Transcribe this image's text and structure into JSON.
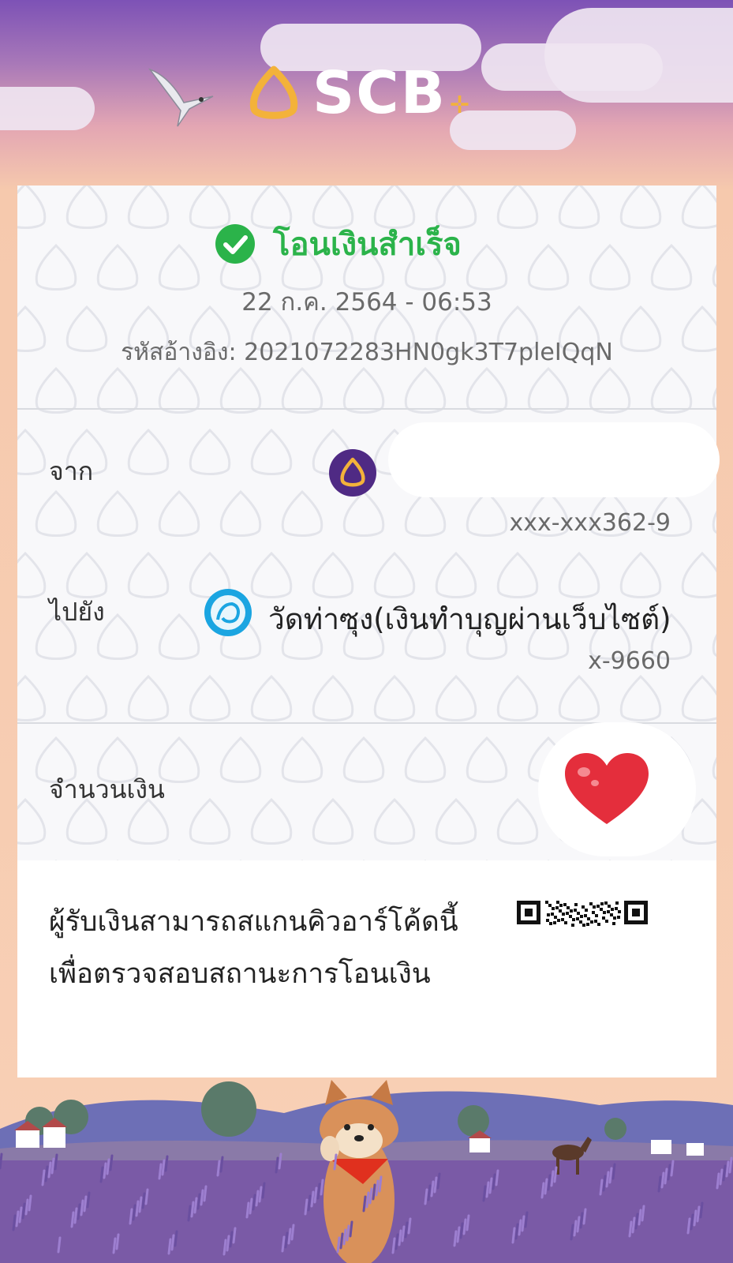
{
  "brand": {
    "name": "SCB",
    "colors": {
      "purple": "#4f2a84",
      "gold": "#f3b23a",
      "success": "#2bb34a"
    }
  },
  "receipt": {
    "status": "โอนเงินสำเร็จ",
    "datetime": "22 ก.ค. 2564 - 06:53",
    "reference": "รหัสอ้างอิง: 2021072283HN0gk3T7pleIQqN",
    "from": {
      "label": "จาก",
      "account": "xxx-xxx362-9",
      "bank_icon": "scb-logo-icon"
    },
    "to": {
      "label": "ไปยัง",
      "name": "วัดท่าซุง(เงินทำบุญผ่านเว็บไซต์)",
      "account": "x-9660",
      "bank_icon": "ktb-logo-icon"
    },
    "amount": {
      "label": "จำนวนเงิน",
      "overlay_icon": "heart-icon"
    },
    "qr_note": {
      "line1": "ผู้รับเงินสามารถสแกนคิวอาร์โค้ดนี้",
      "line2": "เพื่อตรวจสอบสถานะการโอนเงิน"
    }
  }
}
